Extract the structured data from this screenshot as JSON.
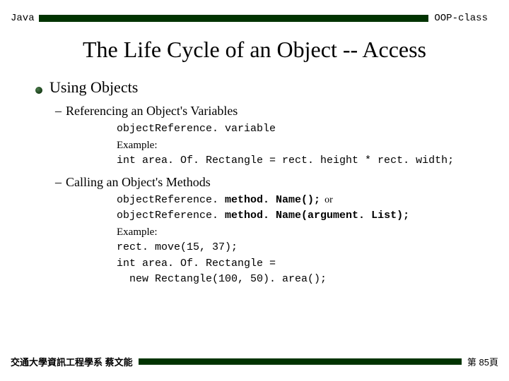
{
  "header": {
    "left": "Java",
    "right": "OOP-class"
  },
  "title": "The Life Cycle of an Object -- Access",
  "section1": {
    "heading": "Using Objects",
    "sub1": {
      "heading": "Referencing an Object's Variables",
      "syntax": "objectReference. variable",
      "exampleLabel": "Example:",
      "exampleCode": "int area. Of. Rectangle = rect. height * rect. width;"
    },
    "sub2": {
      "heading": "Calling an Object's Methods",
      "syntax1_prefix": "objectReference. ",
      "syntax1_bold": "method. Name();",
      "or": "or",
      "syntax2_prefix": "objectReference. ",
      "syntax2_bold": "method. Name(argument. List);",
      "exampleLabel": "Example:",
      "exampleCode1": "rect. move(15, 37);",
      "exampleCode2a": "int area. Of. Rectangle =",
      "exampleCode2b": "  new Rectangle(100, 50). area();"
    }
  },
  "footer": {
    "left": "交通大學資訊工程學系 蔡文能",
    "right": "第 85頁"
  }
}
